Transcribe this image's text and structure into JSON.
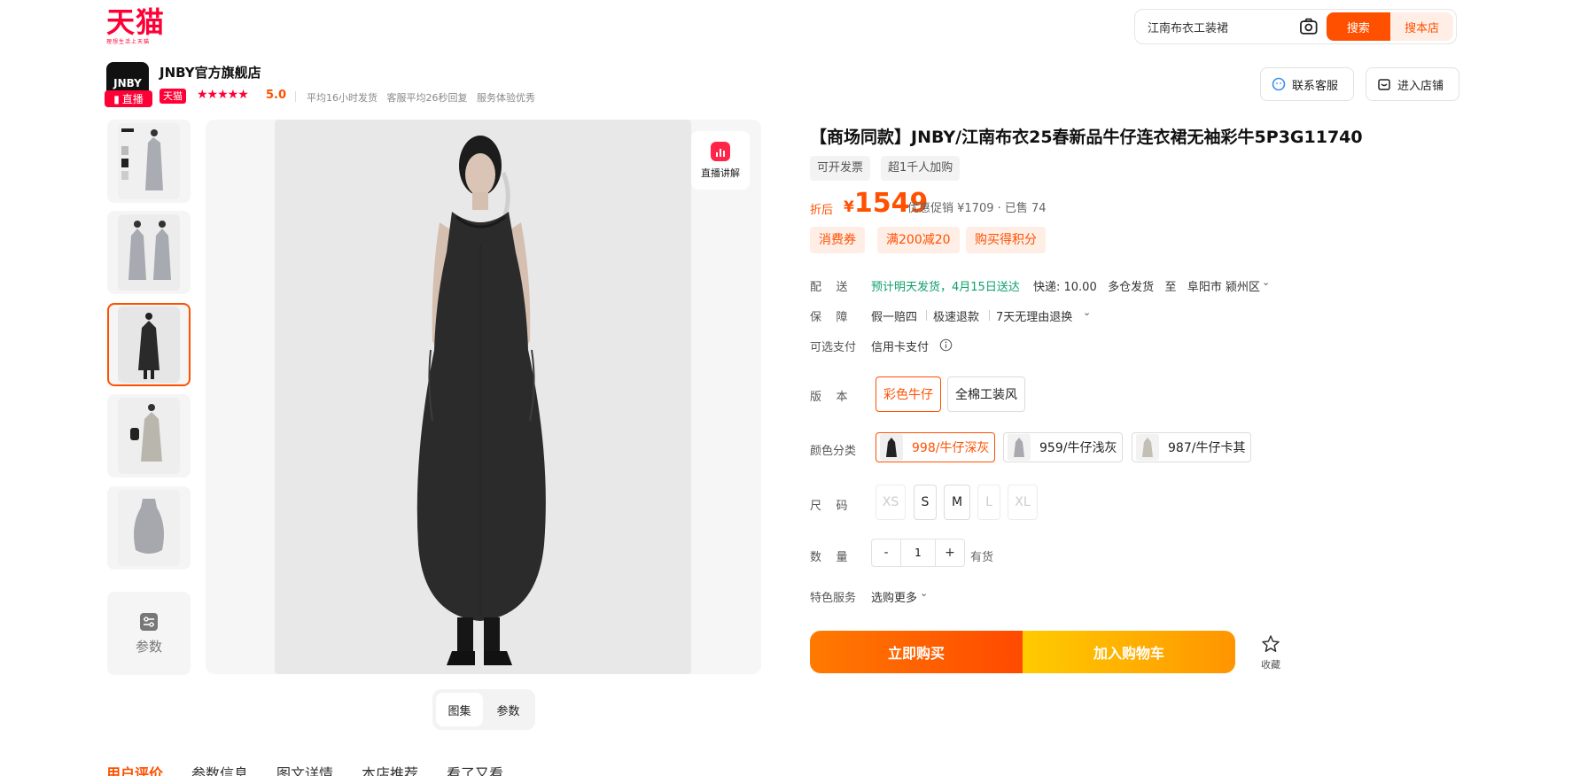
{
  "brand": {
    "logo": "天猫",
    "slogan": "理想生活上天猫",
    "accent": "#ff5000",
    "tmall_red": "#ff0036"
  },
  "search": {
    "value": "江南布衣工装裙",
    "search_label": "搜索",
    "store_search_label": "搜本店"
  },
  "store": {
    "logo_text": "JNBY",
    "live_label": "直播",
    "name": "JNBY官方旗舰店",
    "tmall_tag": "天猫",
    "stars": "★★★★★",
    "rating": "5.0",
    "meta": "平均16小时发货   客服平均26秒回复   服务体验优秀",
    "service_label": "联系客服",
    "enter_label": "进入店铺"
  },
  "gallery": {
    "param_label": "参数",
    "live_explain_label": "直播讲解",
    "tabs": [
      "图集",
      "参数"
    ]
  },
  "product": {
    "title": "【商场同款】JNBY/江南布衣25春新品牛仔连衣裙无袖彩牛5P3G11740",
    "tags": [
      "可开发票",
      "超1千人加购"
    ],
    "price_label": "折后",
    "price_currency": "¥",
    "price": "1549",
    "price_info": "优惠促销 ¥1709 · 已售 74",
    "coupons": [
      "消费券",
      "满200减20",
      "购买得积分"
    ],
    "delivery_label": "配    送",
    "delivery_estimate": "预计明天发货，4月15日送达",
    "delivery_detail": "快递: 10.00   多仓发货   至   阜阳市 颍州区",
    "guarantee_label": "保    障",
    "guarantees": [
      "假一赔四",
      "极速退款",
      "7天无理由退换"
    ],
    "payment_label": "可选支付",
    "payment": "信用卡支付",
    "version_label": "版    本",
    "versions": [
      "彩色牛仔",
      "全棉工装风"
    ],
    "color_label": "颜色分类",
    "colors": [
      "998/牛仔深灰",
      "959/牛仔浅灰",
      "987/牛仔卡其"
    ],
    "size_label": "尺    码",
    "sizes": [
      "XS",
      "S",
      "M",
      "L",
      "XL"
    ],
    "quantity_label": "数    量",
    "quantity": "1",
    "minus": "-",
    "plus": "+",
    "stock": "有货",
    "special_label": "特色服务",
    "special": "选购更多",
    "buy_now": "立即购买",
    "add_cart": "加入购物车",
    "favorite": "收藏"
  },
  "bottom_tabs": [
    "用户评价",
    "参数信息",
    "图文详情",
    "本店推荐",
    "看了又看"
  ]
}
